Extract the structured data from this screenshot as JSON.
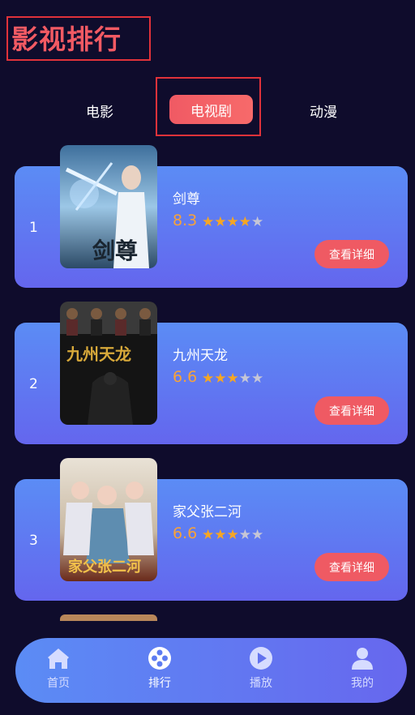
{
  "header": {
    "title": "影视排行"
  },
  "tabs": [
    {
      "label": "电影"
    },
    {
      "label": "电视剧",
      "active": true
    },
    {
      "label": "动漫"
    }
  ],
  "detail_label": "查看详细",
  "rankings": [
    {
      "rank": "1",
      "name": "剑尊",
      "score": "8.3",
      "stars": 4,
      "poster_text": "剑尊"
    },
    {
      "rank": "2",
      "name": "九州天龙",
      "score": "6.6",
      "stars": 3,
      "poster_text": "九州天龙"
    },
    {
      "rank": "3",
      "name": "家父张二河",
      "score": "6.6",
      "stars": 3,
      "poster_text": "家父张二河"
    }
  ],
  "nav": [
    {
      "label": "首页",
      "icon": "home-icon"
    },
    {
      "label": "排行",
      "icon": "film-reel-icon",
      "active": true
    },
    {
      "label": "播放",
      "icon": "play-icon"
    },
    {
      "label": "我的",
      "icon": "user-icon"
    }
  ],
  "colors": {
    "background": "#0f0c2c",
    "accent": "#f05a64",
    "card": "#5b8cf5",
    "star": "#f6a623"
  }
}
